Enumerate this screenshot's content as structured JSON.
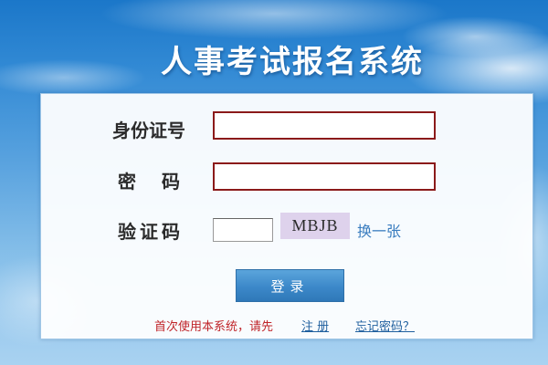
{
  "header": {
    "title": "人事考试报名系统"
  },
  "form": {
    "id_label": "身份证号",
    "id_value": "",
    "password_label": "密　码",
    "password_value": "",
    "captcha_label": "验证码",
    "captcha_value": "",
    "captcha_code": "MBJB",
    "refresh_label": "换一张",
    "login_label": "登录"
  },
  "footer": {
    "prompt": "首次使用本系统，请先",
    "register_label": "注 册",
    "forgot_label": "忘记密码？"
  },
  "colors": {
    "field_border": "#8b1a1a",
    "button": "#3c88c9",
    "prompt_text": "#c0252a",
    "link_text": "#1f5f9e",
    "captcha_bg": "#ded2ec"
  }
}
